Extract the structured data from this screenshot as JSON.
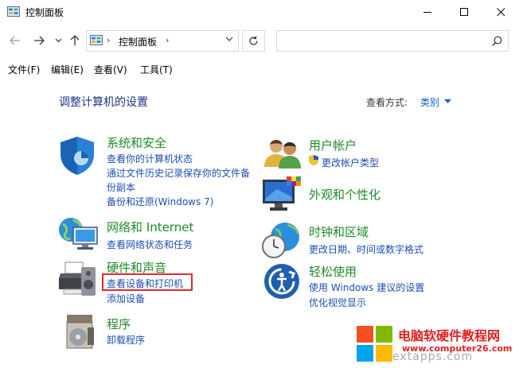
{
  "window": {
    "title": "控制面板",
    "icon": "control-panel-icon"
  },
  "address": {
    "crumb_sep": "›",
    "crumb": "控制面板",
    "search_placeholder": ""
  },
  "menu": {
    "file": "文件(F)",
    "edit": "编辑(E)",
    "view": "查看(V)",
    "tools": "工具(T)"
  },
  "main": {
    "heading": "调整计算机的设置",
    "view_by_label": "查看方式:",
    "view_by_value": "类别"
  },
  "categories": {
    "system": {
      "title": "系统和安全",
      "icon": "shield-icon",
      "links": [
        "查看你的计算机状态",
        "通过文件历史记录保存你的文件备",
        "份副本",
        "备份和还原(Windows 7)"
      ]
    },
    "network": {
      "title": "网络和 Internet",
      "icon": "network-globe-icon",
      "links": [
        "查看网络状态和任务"
      ]
    },
    "hardware": {
      "title": "硬件和声音",
      "icon": "printer-speaker-icon",
      "links": [
        "查看设备和打印机",
        "添加设备"
      ]
    },
    "programs": {
      "title": "程序",
      "icon": "programs-disc-icon",
      "links": [
        "卸载程序"
      ]
    },
    "users": {
      "title": "用户帐户",
      "icon": "users-icon",
      "links": [
        "更改帐户类型"
      ]
    },
    "appearance": {
      "title": "外观和个性化",
      "icon": "monitor-palette-icon",
      "links": []
    },
    "clock": {
      "title": "时钟和区域",
      "icon": "clock-globe-icon",
      "links": [
        "更改日期、时间或数字格式"
      ]
    },
    "ease": {
      "title": "轻松使用",
      "icon": "ease-of-access-icon",
      "links": [
        "使用 Windows 建议的设置",
        "优化视觉显示"
      ]
    }
  },
  "watermark": {
    "name": "电脑软硬件教程网",
    "url": "www.computer26.com",
    "faded": "extapps.com"
  },
  "colors": {
    "category_title": "#1d8b2a",
    "link": "#1a4fb5",
    "heading": "#1e3287",
    "highlight_box": "#e3282d"
  }
}
